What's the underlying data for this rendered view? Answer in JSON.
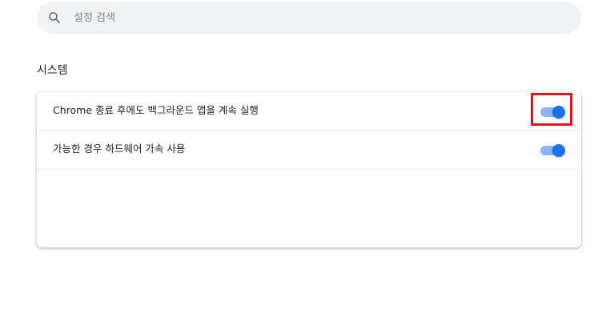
{
  "search": {
    "placeholder": "설정 검색",
    "value": ""
  },
  "section": {
    "title": "시스템"
  },
  "settings": [
    {
      "label": "Chrome 종료 후에도 백그라운드 앱을 계속 실행",
      "enabled": true
    },
    {
      "label": "가능한 경우 하드웨어 가속 사용",
      "enabled": true
    }
  ],
  "colors": {
    "toggle_knob_on": "#1a73e8",
    "toggle_track_on": "#8ab4f8",
    "highlight": "#e3111c",
    "search_bg": "#f1f3f4"
  }
}
